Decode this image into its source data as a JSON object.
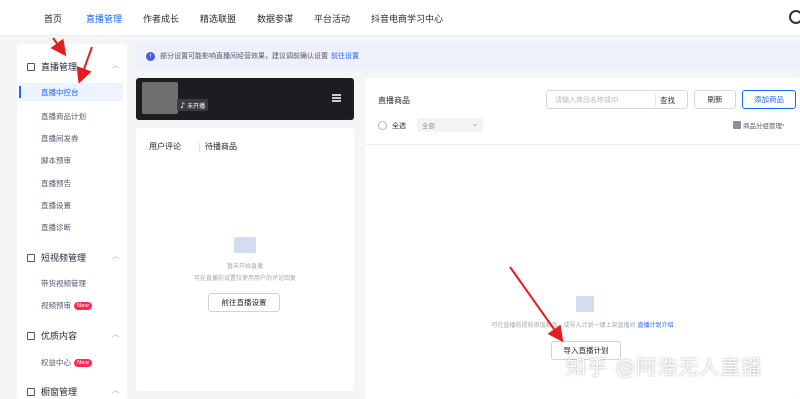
{
  "topnav": {
    "items": [
      "首页",
      "直播管理",
      "作者成长",
      "精选联盟",
      "数据参谋",
      "平台活动",
      "抖音电商学习中心"
    ],
    "active_index": 1
  },
  "sidebar": {
    "groups": [
      {
        "label": "直播管理",
        "items": [
          "直播中控台",
          "直播商品计划",
          "直播间发券",
          "脚本预审",
          "直播预告",
          "直播设置",
          "直播诊断"
        ]
      },
      {
        "label": "短视频管理",
        "items": [
          "带货视频管理",
          "视频预审"
        ],
        "badge_item": "视频预审"
      },
      {
        "label": "优质内容",
        "items": [
          "权益中心"
        ],
        "badge_item": "权益中心"
      },
      {
        "label": "橱窗管理",
        "items": []
      }
    ],
    "badge_text": "New",
    "active_item": "直播中控台"
  },
  "notice": {
    "text": "部分设置可能影响直播间经营效果，建议调前确认设置",
    "link": "前往设置"
  },
  "live_card": {
    "status": "未开播"
  },
  "comments_panel": {
    "tabs": [
      "用户评论",
      "待播商品"
    ],
    "empty_title": "暂未开始直播",
    "empty_desc": "可在直播前设置仅使用用户的评论回复",
    "goto_button": "前往直播设置"
  },
  "goods_panel": {
    "title": "直播商品",
    "search_placeholder": "请输入商品名称或ID",
    "search_button": "查找",
    "refresh_button": "刷新",
    "add_button": "添加商品",
    "select_all": "全选",
    "category_select": "全部",
    "group_manage": "商品分组管理",
    "empty_desc": "可在直播前提前添加商品，或导入计划一键上架直播间",
    "empty_link": "直播计划介绍",
    "import_button": "导入直播计划"
  },
  "watermark": "知乎 @阿浩无人直播",
  "colors": {
    "accent": "#1966ff",
    "badge": "#fe2c55",
    "annotation_arrow": "#e02020"
  }
}
